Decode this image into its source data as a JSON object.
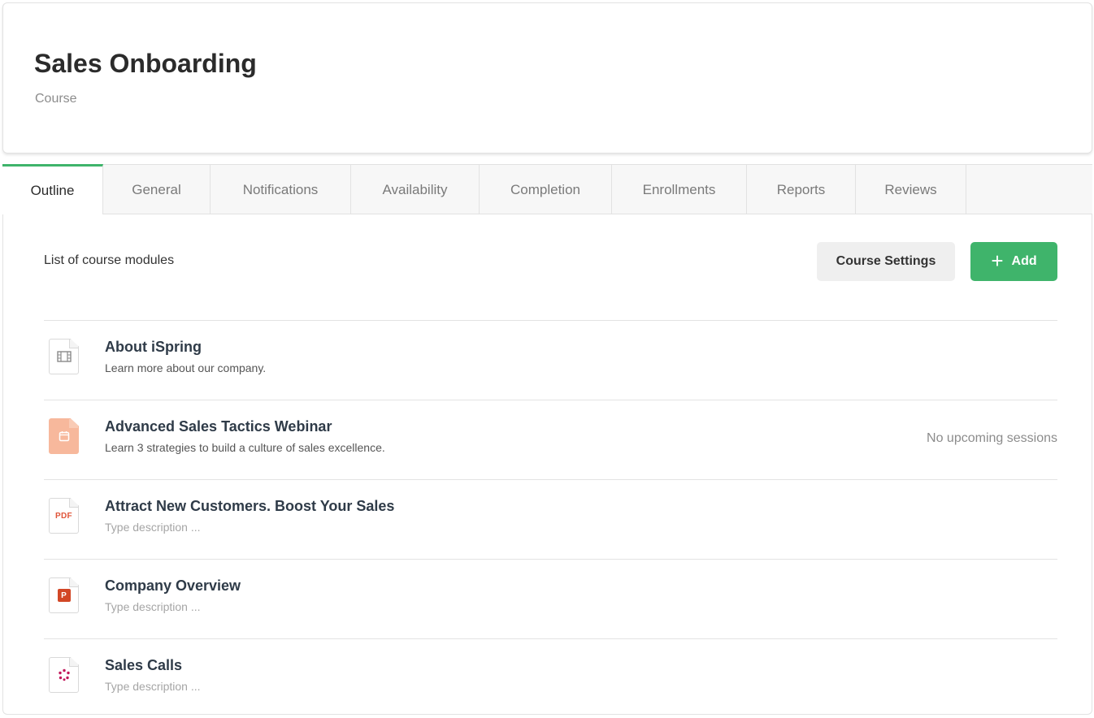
{
  "header": {
    "title": "Sales Onboarding",
    "subtitle": "Course"
  },
  "tabs": [
    {
      "label": "Outline",
      "active": true
    },
    {
      "label": "General"
    },
    {
      "label": "Notifications"
    },
    {
      "label": "Availability"
    },
    {
      "label": "Completion"
    },
    {
      "label": "Enrollments"
    },
    {
      "label": "Reports"
    },
    {
      "label": "Reviews"
    }
  ],
  "toolbar": {
    "caption": "List of course modules",
    "settings_label": "Course Settings",
    "add_label": "Add"
  },
  "modules": [
    {
      "icon": "video-file-icon",
      "title": "About iSpring",
      "description": "Learn more about our company.",
      "status": ""
    },
    {
      "icon": "webinar-calendar-icon",
      "title": "Advanced Sales Tactics Webinar",
      "description": "Learn 3 strategies to build a culture of sales excellence.",
      "status": "No upcoming sessions"
    },
    {
      "icon": "pdf-file-icon",
      "title": "Attract New Customers. Boost Your Sales",
      "description": "Type description ...",
      "status": ""
    },
    {
      "icon": "powerpoint-file-icon",
      "title": "Company Overview",
      "description": "Type description ...",
      "status": ""
    },
    {
      "icon": "ispring-interaction-icon",
      "title": "Sales Calls",
      "description": "Type description ...",
      "status": ""
    }
  ],
  "colors": {
    "accent": "#3fb46b",
    "webinar_icon": "#f7b89c",
    "pdf": "#e0553a",
    "powerpoint": "#d24726",
    "ispring": "#c2185b"
  },
  "icons": {
    "pdf_label": "PDF",
    "ppt_label": "P"
  }
}
